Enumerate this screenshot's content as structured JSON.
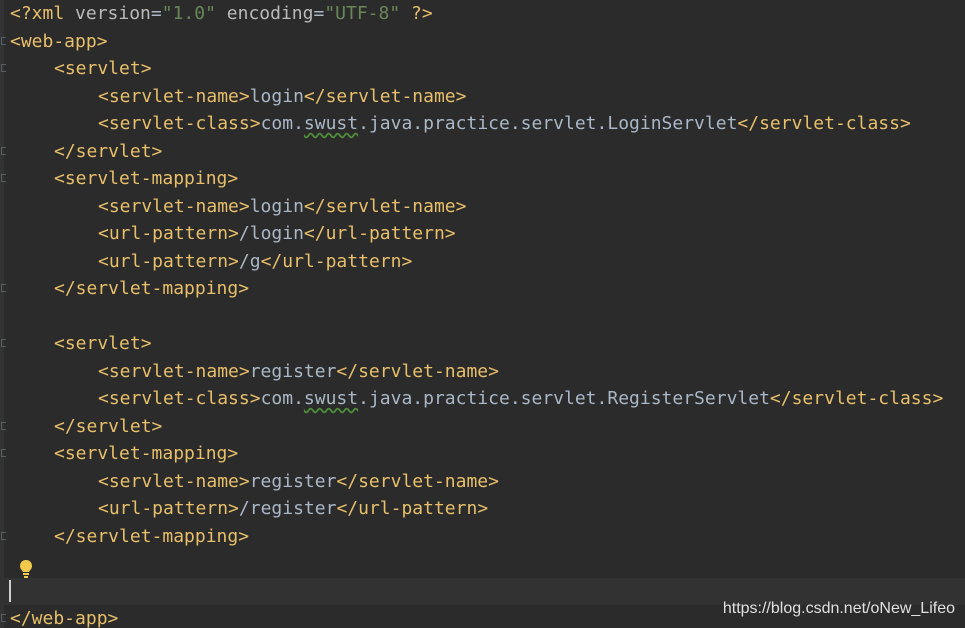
{
  "editor": {
    "lines": [
      {
        "indent": 0,
        "fold": false,
        "tokens": [
          {
            "t": "tag",
            "v": "<?xml "
          },
          {
            "t": "attr",
            "v": "version"
          },
          {
            "t": "plain",
            "v": "="
          },
          {
            "t": "str",
            "v": "\"1.0\""
          },
          {
            "t": "plain",
            "v": " "
          },
          {
            "t": "attr",
            "v": "encoding"
          },
          {
            "t": "plain",
            "v": "="
          },
          {
            "t": "str",
            "v": "\"UTF-8\""
          },
          {
            "t": "tag",
            "v": " ?>"
          }
        ]
      },
      {
        "indent": 0,
        "fold": true,
        "tokens": [
          {
            "t": "tag",
            "v": "<web-app>"
          }
        ]
      },
      {
        "indent": 1,
        "fold": true,
        "tokens": [
          {
            "t": "tag",
            "v": "<servlet>"
          }
        ]
      },
      {
        "indent": 2,
        "fold": false,
        "tokens": [
          {
            "t": "tag",
            "v": "<servlet-name>"
          },
          {
            "t": "plain",
            "v": "login"
          },
          {
            "t": "tag",
            "v": "</servlet-name>"
          }
        ]
      },
      {
        "indent": 2,
        "fold": false,
        "tokens": [
          {
            "t": "tag",
            "v": "<servlet-class>"
          },
          {
            "t": "plain",
            "v": "com."
          },
          {
            "t": "typo",
            "v": "swust"
          },
          {
            "t": "plain",
            "v": ".java.practice.servlet.LoginServlet"
          },
          {
            "t": "tag",
            "v": "</servlet-class>"
          }
        ]
      },
      {
        "indent": 1,
        "fold": true,
        "tokens": [
          {
            "t": "tag",
            "v": "</servlet>"
          }
        ]
      },
      {
        "indent": 1,
        "fold": true,
        "tokens": [
          {
            "t": "tag",
            "v": "<servlet-mapping>"
          }
        ]
      },
      {
        "indent": 2,
        "fold": false,
        "tokens": [
          {
            "t": "tag",
            "v": "<servlet-name>"
          },
          {
            "t": "plain",
            "v": "login"
          },
          {
            "t": "tag",
            "v": "</servlet-name>"
          }
        ]
      },
      {
        "indent": 2,
        "fold": false,
        "tokens": [
          {
            "t": "tag",
            "v": "<url-pattern>"
          },
          {
            "t": "plain",
            "v": "/login"
          },
          {
            "t": "tag",
            "v": "</url-pattern>"
          }
        ]
      },
      {
        "indent": 2,
        "fold": false,
        "tokens": [
          {
            "t": "tag",
            "v": "<url-pattern>"
          },
          {
            "t": "plain",
            "v": "/g"
          },
          {
            "t": "tag",
            "v": "</url-pattern>"
          }
        ]
      },
      {
        "indent": 1,
        "fold": true,
        "tokens": [
          {
            "t": "tag",
            "v": "</servlet-mapping>"
          }
        ]
      },
      {
        "indent": 0,
        "fold": false,
        "tokens": []
      },
      {
        "indent": 1,
        "fold": true,
        "tokens": [
          {
            "t": "tag",
            "v": "<servlet>"
          }
        ]
      },
      {
        "indent": 2,
        "fold": false,
        "tokens": [
          {
            "t": "tag",
            "v": "<servlet-name>"
          },
          {
            "t": "plain",
            "v": "register"
          },
          {
            "t": "tag",
            "v": "</servlet-name>"
          }
        ]
      },
      {
        "indent": 2,
        "fold": false,
        "tokens": [
          {
            "t": "tag",
            "v": "<servlet-class>"
          },
          {
            "t": "plain",
            "v": "com."
          },
          {
            "t": "typo",
            "v": "swust"
          },
          {
            "t": "plain",
            "v": ".java.practice.servlet.RegisterServlet"
          },
          {
            "t": "tag",
            "v": "</servlet-class>"
          }
        ]
      },
      {
        "indent": 1,
        "fold": true,
        "tokens": [
          {
            "t": "tag",
            "v": "</servlet>"
          }
        ]
      },
      {
        "indent": 1,
        "fold": true,
        "tokens": [
          {
            "t": "tag",
            "v": "<servlet-mapping>"
          }
        ]
      },
      {
        "indent": 2,
        "fold": false,
        "tokens": [
          {
            "t": "tag",
            "v": "<servlet-name>"
          },
          {
            "t": "plain",
            "v": "register"
          },
          {
            "t": "tag",
            "v": "</servlet-name>"
          }
        ]
      },
      {
        "indent": 2,
        "fold": false,
        "tokens": [
          {
            "t": "tag",
            "v": "<url-pattern>"
          },
          {
            "t": "plain",
            "v": "/register"
          },
          {
            "t": "tag",
            "v": "</url-pattern>"
          }
        ]
      },
      {
        "indent": 1,
        "fold": true,
        "tokens": [
          {
            "t": "tag",
            "v": "</servlet-mapping>"
          }
        ]
      },
      {
        "indent": 0,
        "fold": false,
        "tokens": []
      },
      {
        "indent": 0,
        "fold": false,
        "current": true,
        "tokens": []
      },
      {
        "indent": 0,
        "fold": true,
        "tokens": [
          {
            "t": "tag",
            "v": "</web-app>"
          }
        ]
      }
    ],
    "intention_icon": "lightbulb-icon",
    "colors": {
      "background": "#2b2b2b",
      "tag": "#e8bf6a",
      "attribute": "#bababa",
      "string": "#6a8759",
      "text": "#a9b7c6",
      "current_line": "#323232"
    }
  },
  "watermark": "https://blog.csdn.net/oNew_Lifeo"
}
